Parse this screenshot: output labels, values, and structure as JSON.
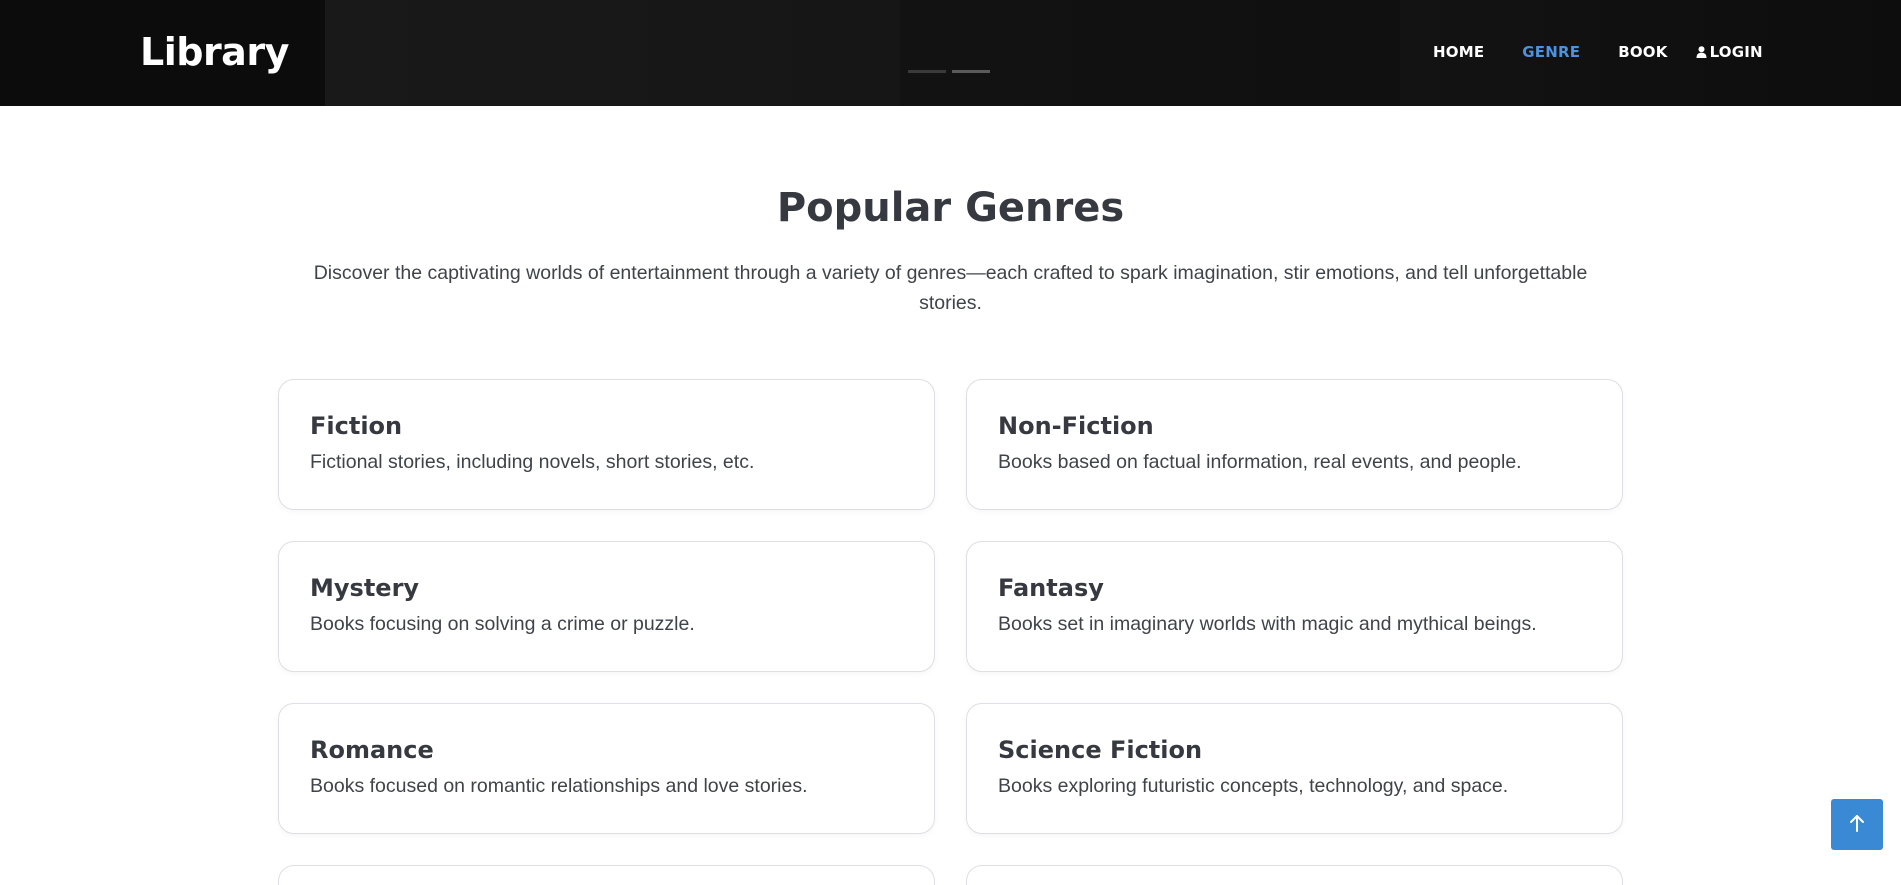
{
  "header": {
    "brand": "Library",
    "nav": [
      {
        "label": "HOME",
        "active": false
      },
      {
        "label": "GENRE",
        "active": true
      },
      {
        "label": "BOOK",
        "active": false
      },
      {
        "label": "LOGIN",
        "active": false,
        "icon": "user-icon"
      }
    ],
    "carousel_slides": 2,
    "carousel_active": 2
  },
  "main": {
    "title": "Popular Genres",
    "description": "Discover the captivating worlds of entertainment through a variety of genres—each crafted to spark imagination, stir emotions, and tell unforgettable stories.",
    "genres": [
      {
        "name": "Fiction",
        "description": "Fictional stories, including novels, short stories, etc."
      },
      {
        "name": "Non-Fiction",
        "description": "Books based on factual information, real events, and people."
      },
      {
        "name": "Mystery",
        "description": "Books focusing on solving a crime or puzzle."
      },
      {
        "name": "Fantasy",
        "description": "Books set in imaginary worlds with magic and mythical beings."
      },
      {
        "name": "Romance",
        "description": "Books focused on romantic relationships and love stories."
      },
      {
        "name": "Science Fiction",
        "description": "Books exploring futuristic concepts, technology, and space."
      }
    ]
  },
  "back_to_top": {
    "icon": "arrow-up-icon"
  },
  "colors": {
    "accent": "#4c92dc",
    "button": "#3a89d4",
    "header_bg": "#0c0c0c",
    "text": "#363a40",
    "card_border": "#dcdfe3"
  }
}
